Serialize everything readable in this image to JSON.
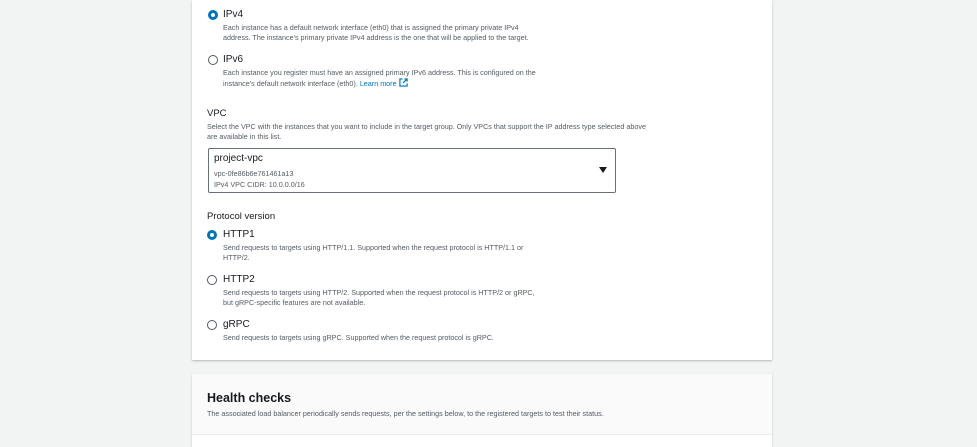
{
  "ip_address_type": {
    "options": [
      {
        "label": "IPv4",
        "checked": true,
        "description_lines": [
          "Each instance has a default network interface (eth0) that is assigned the primary private IPv4",
          "address. The instance's primary private IPv4 address is the one that will be applied to the target."
        ]
      },
      {
        "label": "IPv6",
        "checked": false,
        "description_lines": [
          "Each instance you register must have an assigned primary IPv6 address. This is configured on the",
          "instance's default network interface (eth0)."
        ],
        "link_text": "Learn more"
      }
    ]
  },
  "vpc": {
    "label": "VPC",
    "description_lines": [
      "Select the VPC with the instances that you want to include in the target group. Only VPCs that support the IP address type selected above",
      "are available in this list."
    ],
    "selected": {
      "name": "project-vpc",
      "id": "vpc-0fe86b6e761461a13",
      "cidr": "IPv4 VPC CIDR: 10.0.0.0/16"
    }
  },
  "protocol_version": {
    "label": "Protocol version",
    "options": [
      {
        "label": "HTTP1",
        "checked": true,
        "description_lines": [
          "Send requests to targets using HTTP/1.1. Supported when the request protocol is HTTP/1.1 or",
          "HTTP/2."
        ]
      },
      {
        "label": "HTTP2",
        "checked": false,
        "description_lines": [
          "Send requests to targets using HTTP/2. Supported when the request protocol is HTTP/2 or gRPC,",
          "but gRPC-specific features are not available."
        ]
      },
      {
        "label": "gRPC",
        "checked": false,
        "description_lines": [
          "Send requests to targets using gRPC. Supported when the request protocol is gRPC."
        ]
      }
    ]
  },
  "health_checks": {
    "title": "Health checks",
    "description": "The associated load balancer periodically sends requests, per the settings below, to the registered targets to test their status."
  },
  "colors": {
    "accent": "#0073bb",
    "background": "#f2f3f3",
    "text_secondary": "#545b64"
  }
}
